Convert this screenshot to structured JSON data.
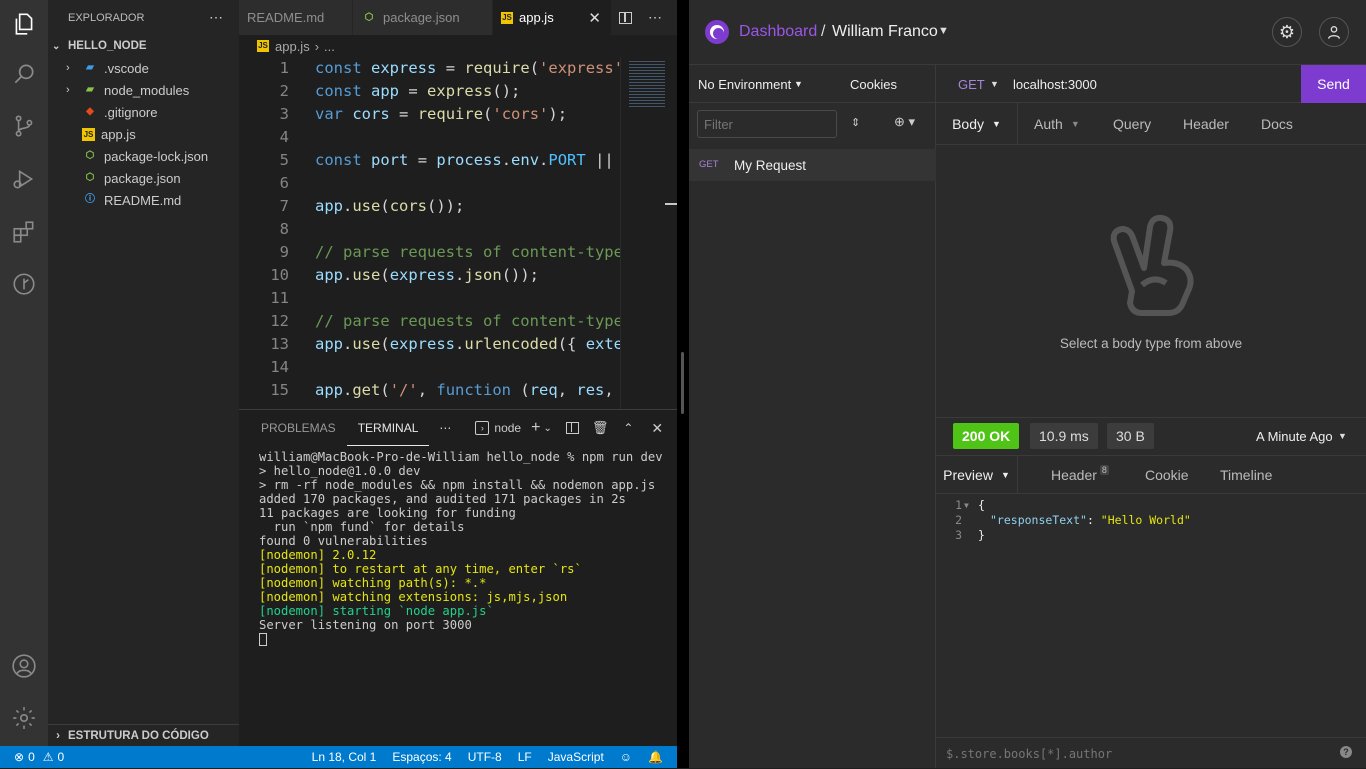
{
  "vscode": {
    "explorer_title": "EXPLORADOR",
    "project": "HELLO_NODE",
    "files": [
      {
        "name": ".vscode",
        "type": "folder-vscode"
      },
      {
        "name": "node_modules",
        "type": "folder-node"
      },
      {
        "name": ".gitignore",
        "type": "git"
      },
      {
        "name": "app.js",
        "type": "js"
      },
      {
        "name": "package-lock.json",
        "type": "json"
      },
      {
        "name": "package.json",
        "type": "json"
      },
      {
        "name": "README.md",
        "type": "info"
      }
    ],
    "outline": "ESTRUTURA DO CÓDIGO",
    "tabs": [
      {
        "label": "README.md"
      },
      {
        "label": "package.json"
      },
      {
        "label": "app.js"
      }
    ],
    "breadcrumb": {
      "file": "app.js",
      "rest": "..."
    },
    "code_lines": [
      "1",
      "2",
      "3",
      "4",
      "5",
      "6",
      "7",
      "8",
      "9",
      "10",
      "11",
      "12",
      "13",
      "14",
      "15"
    ],
    "panel": {
      "tabs": [
        "PROBLEMAS",
        "TERMINAL"
      ],
      "terminal_name": "node"
    },
    "terminal": [
      "william@MacBook-Pro-de-William hello_node % npm run dev",
      "",
      "",
      "> hello_node@1.0.0 dev",
      "> rm -rf node_modules && npm install && nodemon app.js",
      "",
      "",
      "added 170 packages, and audited 171 packages in 2s",
      "",
      "11 packages are looking for funding",
      "  run `npm fund` for details",
      "",
      "found 0 vulnerabilities",
      "[nodemon] 2.0.12",
      "[nodemon] to restart at any time, enter `rs`",
      "[nodemon] watching path(s): *.*",
      "[nodemon] watching extensions: js,mjs,json",
      "[nodemon] starting `node app.js`",
      "Server listening on port 3000"
    ],
    "status": {
      "errors": "0",
      "warnings": "0",
      "position": "Ln 18, Col 1",
      "spaces": "Espaços: 4",
      "encoding": "UTF-8",
      "eol": "LF",
      "language": "JavaScript"
    }
  },
  "insomnia": {
    "breadcrumb_dashboard": "Dashboard",
    "breadcrumb_sep": "/",
    "workspace": "William Franco",
    "environment": "No Environment",
    "cookies": "Cookies",
    "filter_placeholder": "Filter",
    "request": {
      "method": "GET",
      "name": "My Request"
    },
    "url": {
      "method": "GET",
      "value": "localhost:3000",
      "send": "Send"
    },
    "req_tabs": [
      "Body",
      "Auth",
      "Query",
      "Header",
      "Docs"
    ],
    "body_hint": "Select a body type from above",
    "response": {
      "status": "200 OK",
      "time": "10.9 ms",
      "size": "30 B",
      "ago": "A Minute Ago",
      "tabs": [
        "Preview",
        "Header",
        "Cookie",
        "Timeline"
      ],
      "header_count": "8",
      "lines": [
        "1",
        "2",
        "3"
      ],
      "key": "\"responseText\"",
      "value": "\"Hello World\"",
      "filter_placeholder": "$.store.books[*].author"
    },
    "colors": {
      "accent": "#7d3ccf",
      "ok": "#4fc316"
    }
  }
}
